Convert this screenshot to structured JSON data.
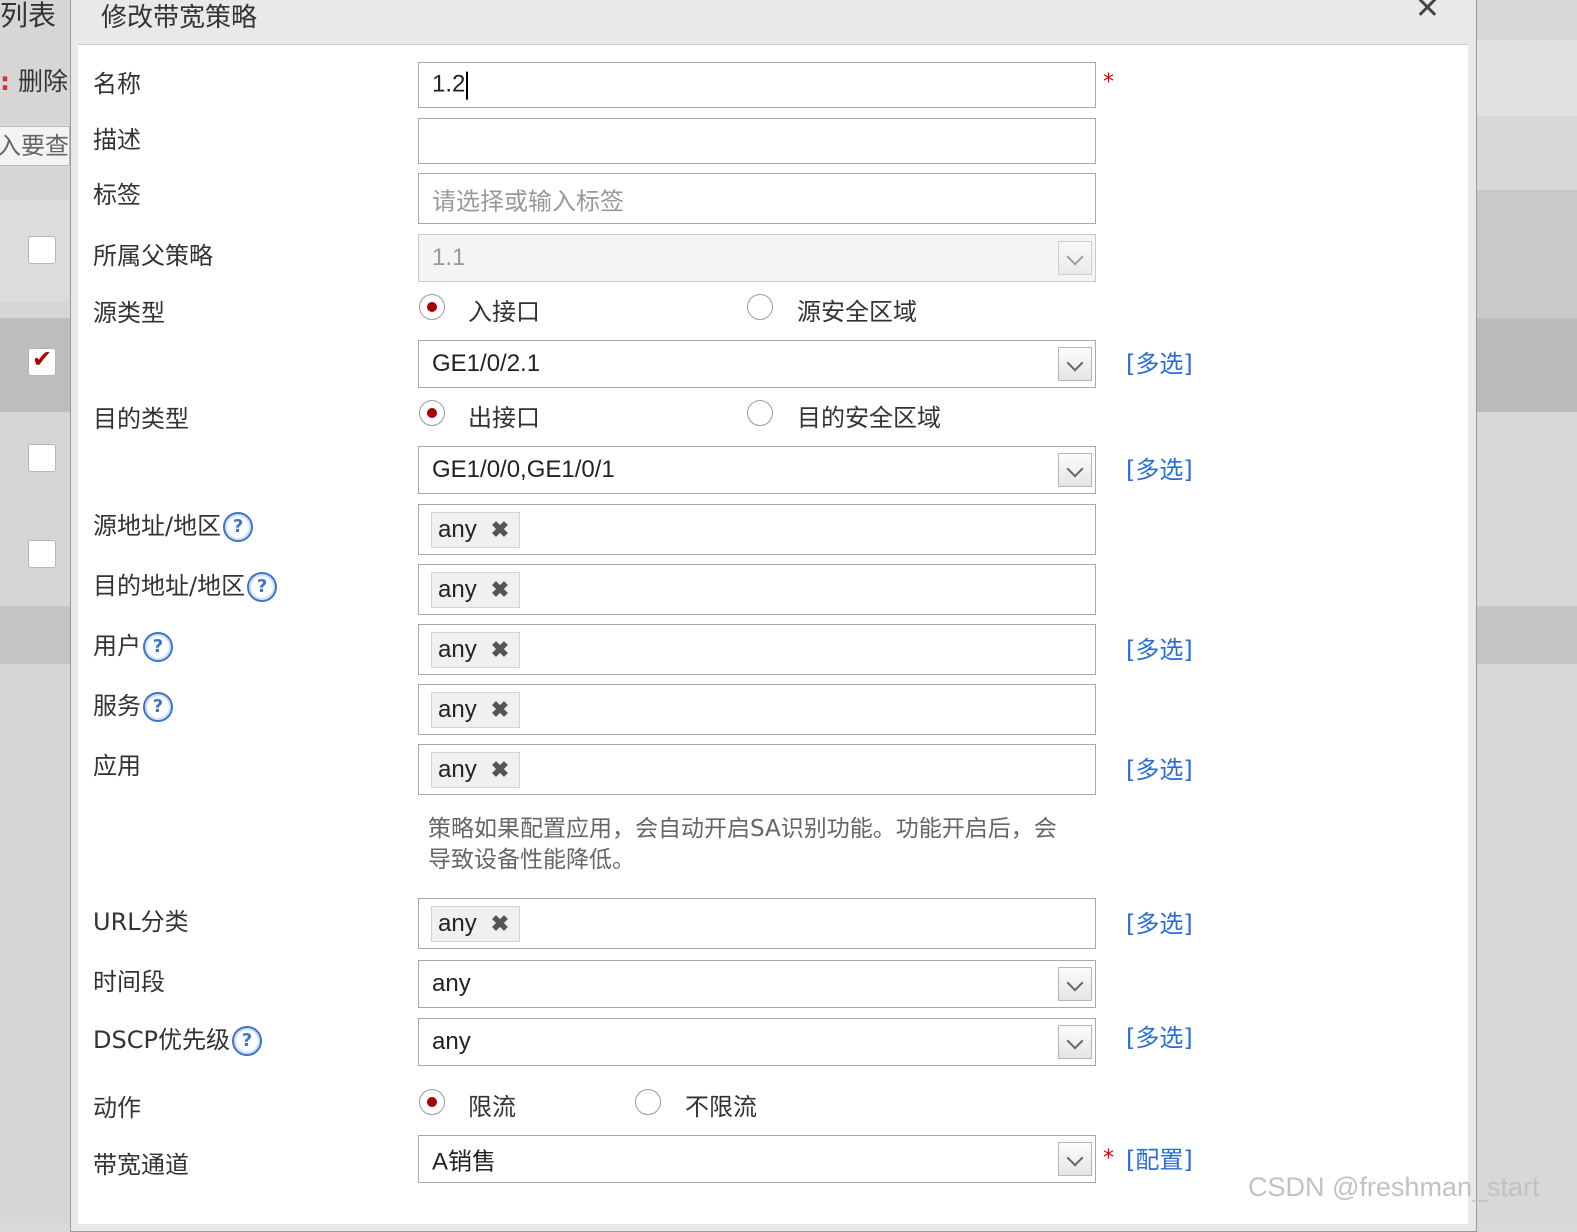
{
  "background": {
    "title_fragment": "列表",
    "delete_label": "删除",
    "search_placeholder": "入要查询",
    "row_checked": [
      false,
      true,
      false,
      false
    ]
  },
  "dialog": {
    "title": "修改带宽策略",
    "close_glyph": "✕"
  },
  "form": {
    "name": {
      "label": "名称",
      "value": "1.2",
      "required_mark": "*"
    },
    "description": {
      "label": "描述",
      "value": ""
    },
    "tags": {
      "label": "标签",
      "placeholder": "请选择或输入标签"
    },
    "parent_policy": {
      "label": "所属父策略",
      "value": "1.1"
    },
    "source_type": {
      "label": "源类型",
      "options": [
        "入接口",
        "源安全区域"
      ],
      "selected": "入接口",
      "value": "GE1/0/2.1",
      "multi_label": "[多选]"
    },
    "dest_type": {
      "label": "目的类型",
      "options": [
        "出接口",
        "目的安全区域"
      ],
      "selected": "出接口",
      "value": "GE1/0/0,GE1/0/1",
      "multi_label": "[多选]"
    },
    "source_address": {
      "label": "源地址/地区",
      "tag": "any"
    },
    "dest_address": {
      "label": "目的地址/地区",
      "tag": "any"
    },
    "user": {
      "label": "用户",
      "tag": "any",
      "multi_label": "[多选]"
    },
    "service": {
      "label": "服务",
      "tag": "any"
    },
    "application": {
      "label": "应用",
      "tag": "any",
      "multi_label": "[多选]"
    },
    "app_note": "策略如果配置应用，会自动开启SA识别功能。功能开启后，会导致设备性能降低。",
    "url_category": {
      "label": "URL分类",
      "tag": "any",
      "multi_label": "[多选]"
    },
    "time_range": {
      "label": "时间段",
      "value": "any"
    },
    "dscp": {
      "label": "DSCP优先级",
      "value": "any",
      "multi_label": "[多选]"
    },
    "action": {
      "label": "动作",
      "options": [
        "限流",
        "不限流"
      ],
      "selected": "限流"
    },
    "bandwidth_channel": {
      "label": "带宽通道",
      "value": "A销售",
      "required_mark": "*",
      "config_label": "[配置]"
    },
    "help_glyph": "?",
    "tag_remove_glyph": "✖"
  },
  "watermark": "CSDN @freshman_start",
  "colors": {
    "link": "#2a6ed5",
    "radio_selected": "#a80000",
    "required": "#dd0000"
  }
}
